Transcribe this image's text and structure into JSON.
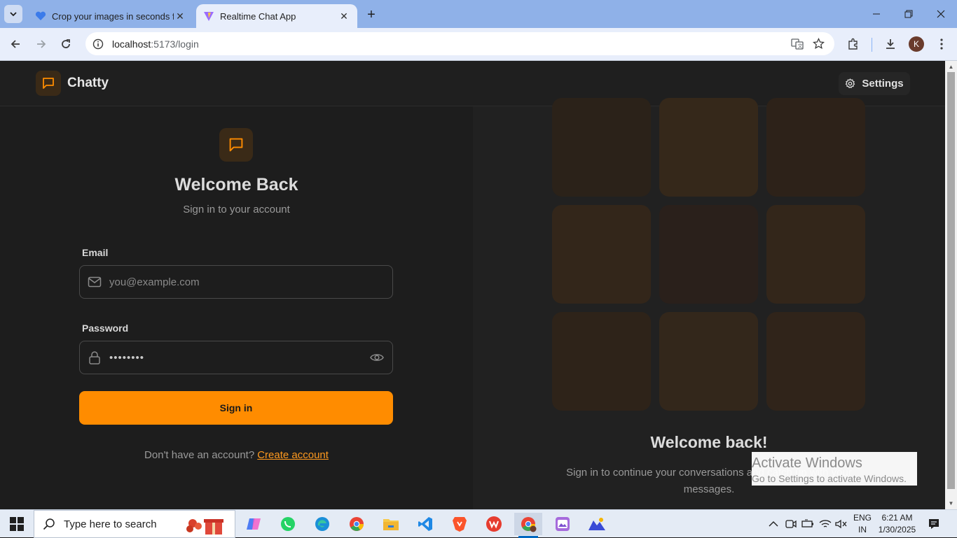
{
  "browser": {
    "tabs": [
      {
        "title": "Crop your images in seconds fo",
        "active": false
      },
      {
        "title": "Realtime Chat App",
        "active": true
      }
    ],
    "url_host": "localhost",
    "url_path": ":5173/login",
    "profile_initial": "K"
  },
  "header": {
    "brand": "Chatty",
    "settings_label": "Settings"
  },
  "login": {
    "title": "Welcome Back",
    "subtitle": "Sign in to your account",
    "email_label": "Email",
    "email_placeholder": "you@example.com",
    "password_label": "Password",
    "password_value": "••••••••",
    "signin_label": "Sign in",
    "no_account_text": "Don't have an account?",
    "create_account_label": "Create account"
  },
  "promo": {
    "title": "Welcome back!",
    "subtitle": "Sign in to continue your conversations and catch up with your messages.",
    "tile_colors": [
      "#2b2219",
      "#35281a",
      "#2d2219",
      "#33261a",
      "#2a201b",
      "#33261a",
      "#2e2319",
      "#33271b",
      "#30241a"
    ]
  },
  "watermark": {
    "line1": "Activate Windows",
    "line2": "Go to Settings to activate Windows."
  },
  "taskbar": {
    "search_placeholder": "Type here to search",
    "language_line1": "ENG",
    "language_line2": "IN",
    "time": "6:21 AM",
    "date": "1/30/2025"
  },
  "colors": {
    "accent": "#ff8c00",
    "background": "#1d1d1d",
    "panel": "#212121",
    "link": "#ff9a1f"
  }
}
